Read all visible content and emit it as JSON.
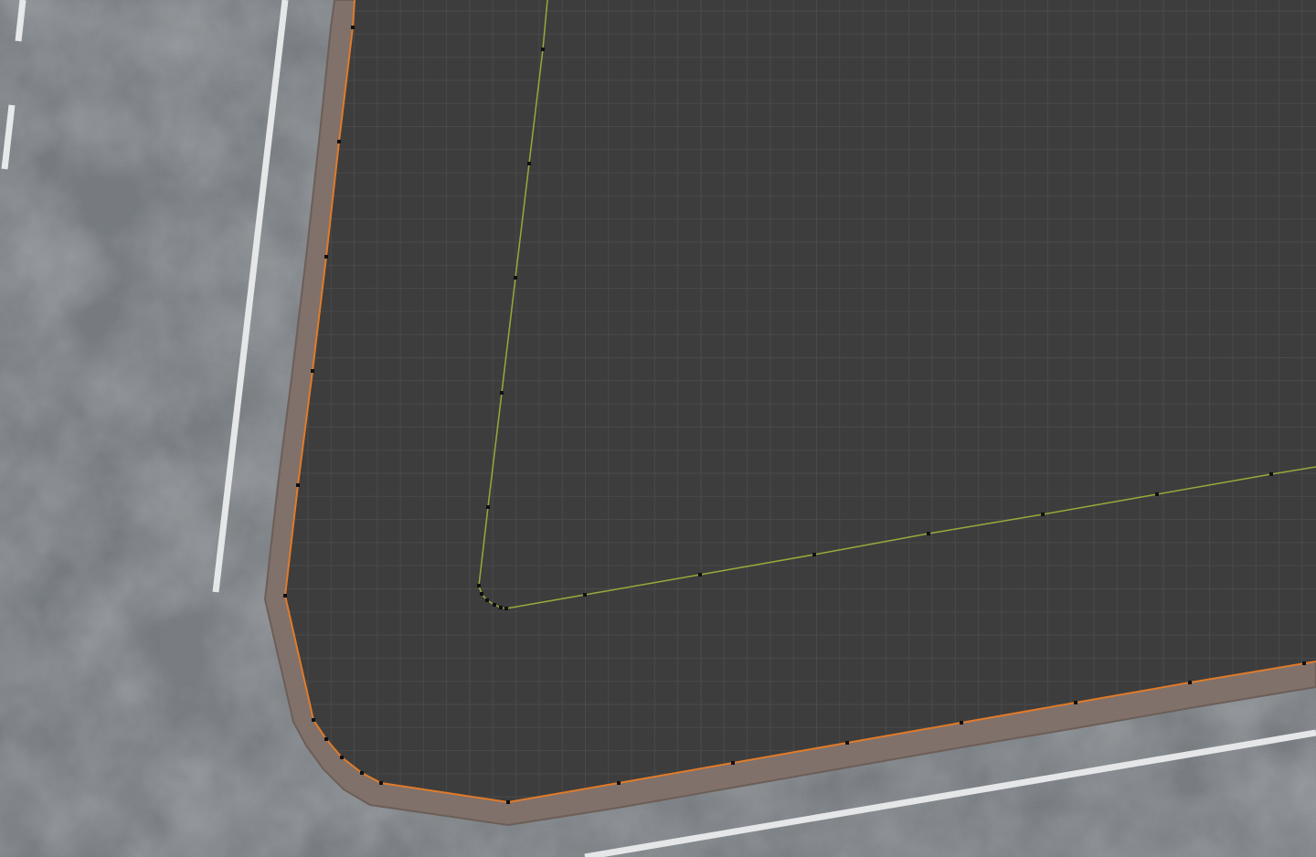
{
  "viewport": {
    "mode": "edit-mode",
    "view": "top-orthographic"
  },
  "colors": {
    "asphalt": "#6f7479",
    "asphalt_light": "#8a8f94",
    "asphalt_dark": "#5a5f64",
    "lane_marking": "#e6e8ea",
    "curb": "#7f6f68",
    "curb_edge": "#6a5c55",
    "plaza_fill": "#3d3d3d",
    "grid_line": "#4a4a4a",
    "selected_edge": "#e07b2a",
    "curve_line": "#9aa83a",
    "vertex": "#101010"
  },
  "objects": [
    {
      "name": "road-surface",
      "icon": "none"
    },
    {
      "name": "curb-mesh",
      "state": "selected"
    },
    {
      "name": "plaza-plane",
      "state": "active"
    },
    {
      "name": "guide-curve",
      "state": "visible"
    }
  ]
}
